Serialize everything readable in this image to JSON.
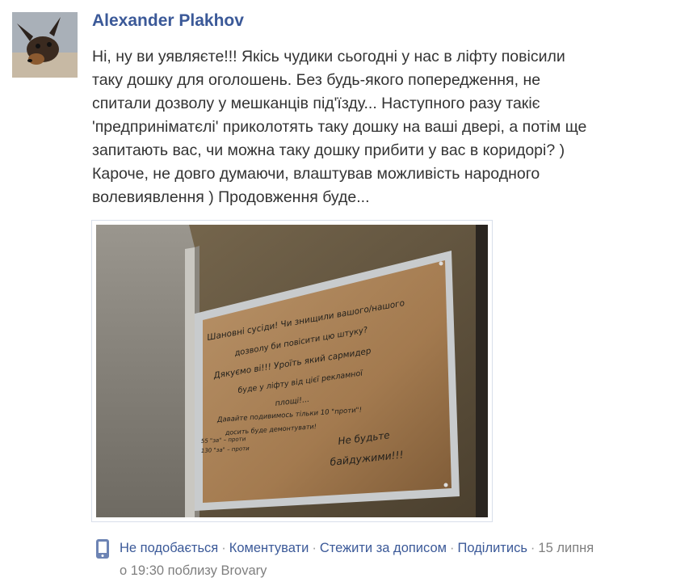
{
  "post": {
    "author": "Alexander Plakhov",
    "message": "Ні, ну ви уявляєте!!! Якісь чудики сьогодні у нас в ліфту повісили\nтаку дошку для оголошень. Без будь-якого попередження, не\nспитали дозволу у мешканців під'їзду... Наступного разу такіє\n'предприніматєлі' приколотять таку дошку на ваші двері, а потім ще\nзапитають вас, чи можна таку дошку прибити у вас в коридорі? )\nКароче, не довго думаючи, влаштував можливість народного\nволевиявлення ) Продовження буде...",
    "photo": {
      "board_text": [
        "Шановні сусіди! Чи знищили вашого/нашого",
        "дозволу би повісити цю штуку?",
        "Дякуємо ві!!! Уроїть який сармидер",
        "буде у ліфту від цієї рекламної",
        "площі!...",
        "Давайте подивимось тільки 10 \"проти\"!",
        "досить буде демонтувати!",
        "Не будьте",
        "байдужими!!!",
        "55 \"за\" – проти",
        "130 \"за\" – проти"
      ]
    }
  },
  "actions": {
    "unlike": "Не подобається",
    "comment": "Коментувати",
    "follow": "Стежити за дописом",
    "share": "Поділитись",
    "separator": "·",
    "timestamp": "15 липня",
    "timestamp_line2": "о 19:30 поблизу Brovary"
  },
  "icons": {
    "mobile": "mobile-phone-icon"
  },
  "colors": {
    "link": "#3b5998",
    "text": "#333333",
    "meta": "#7f7f7f"
  }
}
